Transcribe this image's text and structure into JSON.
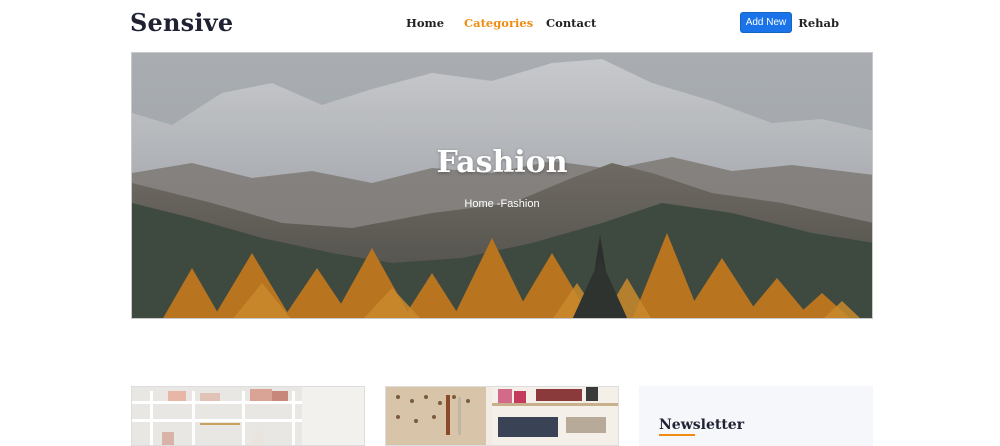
{
  "brand": "Sensive",
  "nav": {
    "items": [
      {
        "label": "Home",
        "active": false
      },
      {
        "label": "Categories",
        "active": true
      },
      {
        "label": "Contact",
        "active": false
      }
    ]
  },
  "header": {
    "add_new_label": "Add New",
    "user_name": "Rehab"
  },
  "hero": {
    "title": "Fashion",
    "breadcrumb_home": "Home",
    "breadcrumb_sep": " -",
    "breadcrumb_current": "Fashion"
  },
  "sidebar": {
    "newsletter_title": "Newsletter"
  },
  "colors": {
    "accent": "#f08c12",
    "button": "#1a73e8",
    "brand_text": "#1f2233"
  }
}
